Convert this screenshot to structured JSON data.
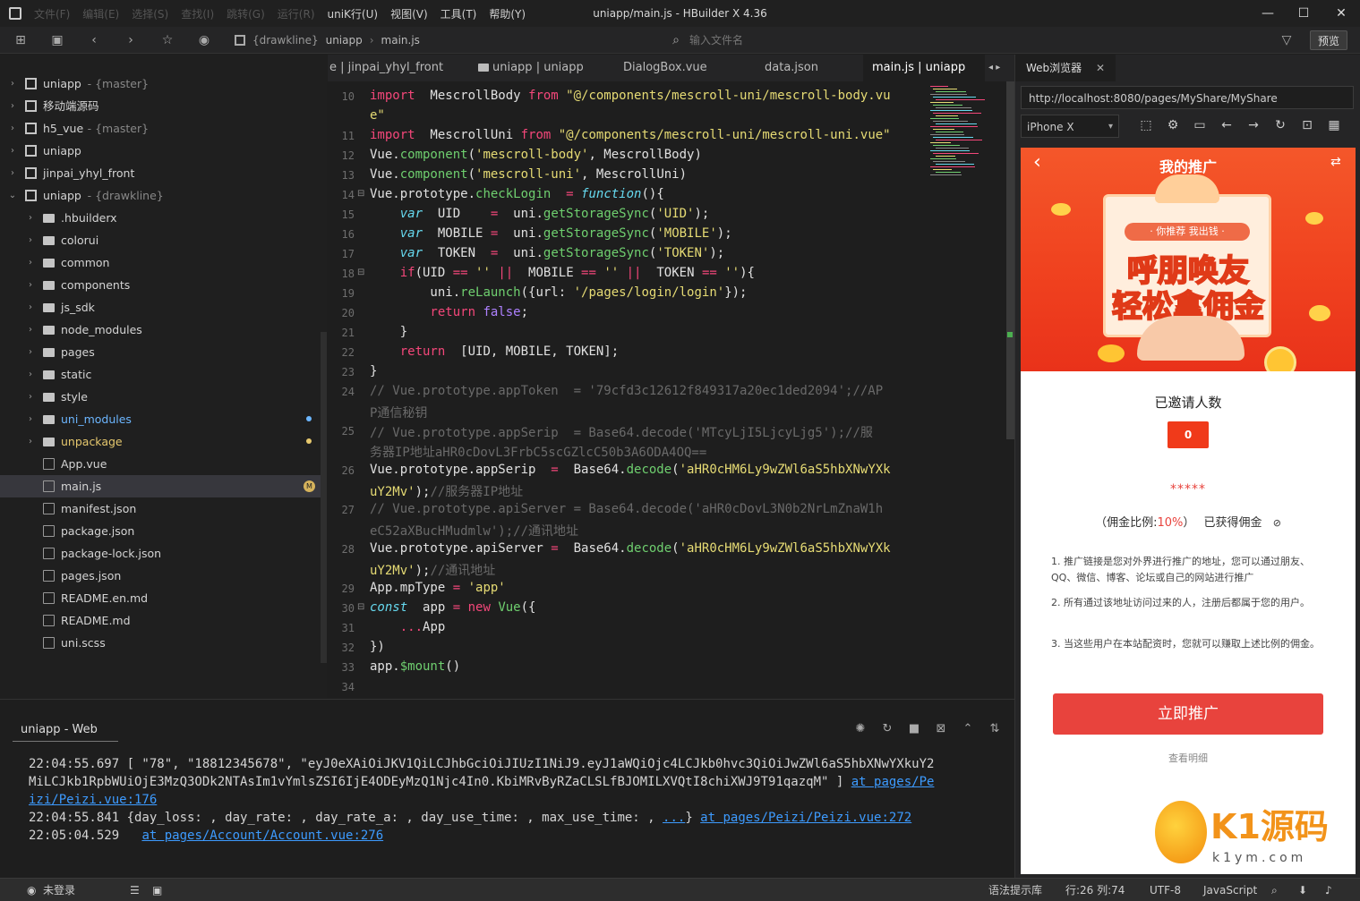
{
  "titlebar": {
    "menu": [
      "文件(F)",
      "编辑(E)",
      "选择(S)",
      "查找(I)",
      "跳转(G)",
      "运行(R)",
      "uniK行(U)",
      "视图(V)",
      "工具(T)",
      "帮助(Y)"
    ],
    "title": "uniapp/main.js - HBuilder X 4.36",
    "minimize": "—",
    "maximize": "☐",
    "close": "✕"
  },
  "toolbar": {
    "crumb_root": "{drawkline}",
    "crumb_project": "uniapp",
    "crumb_sep": "›",
    "crumb_file": "main.js",
    "file_input_placeholder": "输入文件名",
    "preview_label": "预览"
  },
  "sidebar": {
    "items": [
      {
        "label": "uniapp",
        "branch": "- {master}",
        "arrow": "›",
        "icon": "project",
        "depth": 0
      },
      {
        "label": "移动端源码",
        "branch": "",
        "arrow": "›",
        "icon": "folder-project",
        "depth": 0
      },
      {
        "label": "h5_vue",
        "branch": "- {master}",
        "arrow": "›",
        "icon": "project",
        "depth": 0
      },
      {
        "label": "uniapp",
        "branch": "",
        "arrow": "›",
        "icon": "project",
        "depth": 0
      },
      {
        "label": "jinpai_yhyl_front",
        "branch": "",
        "arrow": "›",
        "icon": "project",
        "depth": 0
      },
      {
        "label": "uniapp",
        "branch": "- {drawkline}",
        "arrow": "⌄",
        "icon": "project",
        "depth": 0
      },
      {
        "label": ".hbuilderx",
        "branch": "",
        "arrow": "›",
        "icon": "folder",
        "depth": 1
      },
      {
        "label": "colorui",
        "branch": "",
        "arrow": "›",
        "icon": "folder",
        "depth": 1
      },
      {
        "label": "common",
        "branch": "",
        "arrow": "›",
        "icon": "folder",
        "depth": 1
      },
      {
        "label": "components",
        "branch": "",
        "arrow": "›",
        "icon": "folder",
        "depth": 1
      },
      {
        "label": "js_sdk",
        "branch": "",
        "arrow": "›",
        "icon": "folder",
        "depth": 1
      },
      {
        "label": "node_modules",
        "branch": "",
        "arrow": "›",
        "icon": "folder",
        "depth": 1
      },
      {
        "label": "pages",
        "branch": "",
        "arrow": "›",
        "icon": "folder",
        "depth": 1
      },
      {
        "label": "static",
        "branch": "",
        "arrow": "›",
        "icon": "folder",
        "depth": 1
      },
      {
        "label": "style",
        "branch": "",
        "arrow": "›",
        "icon": "folder",
        "depth": 1
      },
      {
        "label": "uni_modules",
        "branch": "",
        "arrow": "›",
        "icon": "folder",
        "depth": 1,
        "color": "#6cb6ff",
        "dot": "#6cb6ff"
      },
      {
        "label": "unpackage",
        "branch": "",
        "arrow": "›",
        "icon": "folder",
        "depth": 1,
        "color": "#e6c86e",
        "dot": "#e6c86e"
      },
      {
        "label": "App.vue",
        "branch": "",
        "arrow": "",
        "icon": "vue",
        "depth": 1
      },
      {
        "label": "main.js",
        "branch": "",
        "arrow": "",
        "icon": "js",
        "depth": 1,
        "selected": true,
        "badge": "M"
      },
      {
        "label": "manifest.json",
        "branch": "",
        "arrow": "",
        "icon": "manifest",
        "depth": 1
      },
      {
        "label": "package.json",
        "branch": "",
        "arrow": "",
        "icon": "json",
        "depth": 1
      },
      {
        "label": "package-lock.json",
        "branch": "",
        "arrow": "",
        "icon": "json",
        "depth": 1
      },
      {
        "label": "pages.json",
        "branch": "",
        "arrow": "",
        "icon": "json",
        "depth": 1
      },
      {
        "label": "README.en.md",
        "branch": "",
        "arrow": "",
        "icon": "md",
        "depth": 1
      },
      {
        "label": "README.md",
        "branch": "",
        "arrow": "",
        "icon": "md",
        "depth": 1
      },
      {
        "label": "uni.scss",
        "branch": "",
        "arrow": "",
        "icon": "scss",
        "depth": 1
      }
    ]
  },
  "tabs": [
    "e | jinpai_yhyl_front",
    "uniapp | uniapp",
    "DialogBox.vue",
    "data.json",
    "main.js | uniapp"
  ],
  "tab_scroll": "◂ ▸",
  "editor": {
    "lines": [
      {
        "n": "10",
        "fold": "",
        "t": [
          [
            "k",
            "import"
          ],
          [
            "",
            "  MescrollBody "
          ],
          [
            "k",
            "from"
          ],
          [
            "",
            ""
          ],
          [
            "s",
            " \"@/components/mescroll-uni/mescroll-body.vu"
          ]
        ]
      },
      {
        "n": "",
        "fold": "",
        "t": [
          [
            "s",
            "e\""
          ]
        ]
      },
      {
        "n": "11",
        "fold": "",
        "t": [
          [
            "k",
            "import"
          ],
          [
            "",
            "  MescrollUni "
          ],
          [
            "k",
            "from"
          ],
          [
            "s",
            " \"@/components/mescroll-uni/mescroll-uni.vue\""
          ]
        ]
      },
      {
        "n": "12",
        "fold": "",
        "t": [
          [
            "",
            "Vue."
          ],
          [
            "f",
            "component"
          ],
          [
            "",
            "("
          ],
          [
            "s",
            "'mescroll-body'"
          ],
          [
            "",
            ", MescrollBody)"
          ]
        ]
      },
      {
        "n": "13",
        "fold": "",
        "t": [
          [
            "",
            "Vue."
          ],
          [
            "f",
            "component"
          ],
          [
            "",
            "("
          ],
          [
            "s",
            "'mescroll-uni'"
          ],
          [
            "",
            ", MescrollUni)"
          ]
        ]
      },
      {
        "n": "14",
        "fold": "⊟",
        "t": [
          [
            "",
            "Vue.prototype."
          ],
          [
            "f",
            "checkLogin"
          ],
          [
            "",
            "  "
          ],
          [
            "k",
            "="
          ],
          [
            "",
            ""
          ],
          [
            "v",
            " function"
          ],
          [
            "",
            "(){"
          ]
        ]
      },
      {
        "n": "15",
        "fold": "",
        "t": [
          [
            "v",
            "    var"
          ],
          [
            "",
            "  UID    "
          ],
          [
            "k",
            "="
          ],
          [
            "",
            "  uni."
          ],
          [
            "f",
            "getStorageSync"
          ],
          [
            "",
            "("
          ],
          [
            "s",
            "'UID'"
          ],
          [
            "",
            ");"
          ]
        ]
      },
      {
        "n": "16",
        "fold": "",
        "t": [
          [
            "v",
            "    var"
          ],
          [
            "",
            "  MOBILE "
          ],
          [
            "k",
            "="
          ],
          [
            "",
            "  uni."
          ],
          [
            "f",
            "getStorageSync"
          ],
          [
            "",
            "("
          ],
          [
            "s",
            "'MOBILE'"
          ],
          [
            "",
            ");"
          ]
        ]
      },
      {
        "n": "17",
        "fold": "",
        "t": [
          [
            "v",
            "    var"
          ],
          [
            "",
            "  TOKEN  "
          ],
          [
            "k",
            "="
          ],
          [
            "",
            "  uni."
          ],
          [
            "f",
            "getStorageSync"
          ],
          [
            "",
            "("
          ],
          [
            "s",
            "'TOKEN'"
          ],
          [
            "",
            ");"
          ]
        ]
      },
      {
        "n": "18",
        "fold": "⊟",
        "t": [
          [
            "k",
            "    if"
          ],
          [
            "",
            "(UID "
          ],
          [
            "k",
            "=="
          ],
          [
            "s",
            " ''"
          ],
          [
            "k",
            " ||"
          ],
          [
            "",
            "  MOBILE "
          ],
          [
            "k",
            "=="
          ],
          [
            "s",
            " ''"
          ],
          [
            "k",
            " ||"
          ],
          [
            "",
            "  TOKEN "
          ],
          [
            "k",
            "=="
          ],
          [
            "s",
            " ''"
          ],
          [
            "",
            "){"
          ]
        ]
      },
      {
        "n": "19",
        "fold": "",
        "t": [
          [
            "",
            "        uni."
          ],
          [
            "f",
            "reLaunch"
          ],
          [
            "",
            "({url:"
          ],
          [
            "s",
            " '/pages/login/login'"
          ],
          [
            "",
            "});"
          ]
        ]
      },
      {
        "n": "20",
        "fold": "",
        "t": [
          [
            "k",
            "        return"
          ],
          [
            "n",
            " false"
          ],
          [
            "",
            ";"
          ]
        ]
      },
      {
        "n": "21",
        "fold": "",
        "t": [
          [
            "",
            "    }"
          ]
        ]
      },
      {
        "n": "22",
        "fold": "",
        "t": [
          [
            "k",
            "    return"
          ],
          [
            "",
            "  [UID, MOBILE, TOKEN];"
          ]
        ]
      },
      {
        "n": "23",
        "fold": "",
        "t": [
          [
            "",
            "}"
          ]
        ]
      },
      {
        "n": "24",
        "fold": "",
        "t": [
          [
            "c",
            "// Vue.prototype.appToken  = '79cfd3c12612f849317a20ec1ded2094';//AP"
          ]
        ]
      },
      {
        "n": "",
        "fold": "",
        "t": [
          [
            "c",
            "P通信秘钥"
          ]
        ]
      },
      {
        "n": "25",
        "fold": "",
        "t": [
          [
            "c",
            "// Vue.prototype.appSerip  = Base64.decode('MTcyLjI5LjcyLjg5');//服"
          ]
        ]
      },
      {
        "n": "",
        "fold": "",
        "t": [
          [
            "c",
            "务器IP地址aHR0cDovL3FrbC5scGZlcC50b3A6ODA4OQ=="
          ]
        ]
      },
      {
        "n": "26",
        "fold": "",
        "t": [
          [
            "",
            "Vue.prototype.appSerip  "
          ],
          [
            "k",
            "="
          ],
          [
            "",
            "  Base64."
          ],
          [
            "f",
            "decode"
          ],
          [
            "",
            "("
          ],
          [
            "s",
            "'aHR0cHM6Ly9wZWl6aS5hbXNwYXk"
          ]
        ]
      },
      {
        "n": "",
        "fold": "",
        "t": [
          [
            "s",
            "uY2Mv'"
          ],
          [
            "",
            ");"
          ],
          [
            "c",
            "//服务器IP地址"
          ]
        ]
      },
      {
        "n": "27",
        "fold": "",
        "t": [
          [
            "c",
            "// Vue.prototype.apiServer = Base64.decode('aHR0cDovL3N0b2NrLmZnaW1h"
          ]
        ]
      },
      {
        "n": "",
        "fold": "",
        "t": [
          [
            "c",
            "eC52aXBucHMudmlw');//通讯地址"
          ]
        ]
      },
      {
        "n": "28",
        "fold": "",
        "t": [
          [
            "",
            "Vue.prototype.apiServer "
          ],
          [
            "k",
            "="
          ],
          [
            "",
            "  Base64."
          ],
          [
            "f",
            "decode"
          ],
          [
            "",
            "("
          ],
          [
            "s",
            "'aHR0cHM6Ly9wZWl6aS5hbXNwYXk"
          ]
        ]
      },
      {
        "n": "",
        "fold": "",
        "t": [
          [
            "s",
            "uY2Mv'"
          ],
          [
            "",
            ");"
          ],
          [
            "c",
            "//通讯地址"
          ]
        ]
      },
      {
        "n": "29",
        "fold": "",
        "t": [
          [
            "",
            "App.mpType "
          ],
          [
            "k",
            "="
          ],
          [
            "s",
            " 'app'"
          ]
        ]
      },
      {
        "n": "30",
        "fold": "⊟",
        "t": [
          [
            "v",
            "const"
          ],
          [
            "",
            "  app "
          ],
          [
            "k",
            "="
          ],
          [
            "k",
            " new"
          ],
          [
            "f",
            " Vue"
          ],
          [
            "",
            "({"
          ]
        ]
      },
      {
        "n": "31",
        "fold": "",
        "t": [
          [
            "k",
            "    ..."
          ],
          [
            "",
            "App"
          ]
        ]
      },
      {
        "n": "32",
        "fold": "",
        "t": [
          [
            "",
            "})"
          ]
        ]
      },
      {
        "n": "33",
        "fold": "",
        "t": [
          [
            "",
            "app."
          ],
          [
            "f",
            "$mount"
          ],
          [
            "",
            "()"
          ]
        ]
      },
      {
        "n": "34",
        "fold": "",
        "t": [
          [
            "",
            ""
          ]
        ]
      }
    ]
  },
  "browser": {
    "tab_label": "Web浏览器",
    "tab_close": "✕",
    "url": "http://localhost:8080/pages/MyShare/MyShare",
    "device": "iPhone X",
    "device_arrow": "▾"
  },
  "phone": {
    "header_title": "我的推广",
    "banner_tag": "· 你推荐 我出钱 ·",
    "banner_line1": "呼朋唤友",
    "banner_line2": "轻松拿佣金",
    "invited_label": "已邀请人数",
    "invited_count": "0",
    "masked": "*****",
    "ratio_prefix": "（佣金比例:",
    "ratio_value": "10%",
    "ratio_suffix": "）",
    "earned_label": "已获得佣金",
    "rule1": "1. 推广链接是您对外界进行推广的地址，您可以通过朋友、QQ、微信、博客、论坛或自己的网站进行推广",
    "rule2": "2. 所有通过该地址访问过来的人，注册后都属于您的用户。",
    "rule3": "3. 当这些用户在本站配资时，您就可以赚取上述比例的佣金。",
    "promote_button": "立即推广",
    "details_link": "查看明细",
    "watermark_main": "K1源码",
    "watermark_sub": "k1ym.com",
    "colors": {
      "red": "#e8433d",
      "orange": "#f0461f"
    }
  },
  "console": {
    "tab_label": "uniapp - Web",
    "lines": [
      [
        [
          "",
          "22:04:55.697 [ \"78\", \"18812345678\", \"eyJ0eXAiOiJKV1QiLCJhbGciOiJIUzI1NiJ9.eyJ1aWQiOjc4LCJkb0hvc3QiOiJwZWl6aS5hbXNwYXkuY2"
        ]
      ],
      [
        [
          "",
          "MiLCJkb1RpbWUiOjE3MzQ3ODk2NTAsIm1vYmlsZSI6IjE4ODEyMzQ1Njc4In0.KbiMRvByRZaCLSLfBJOMILXVQtI8chiXWJ9T91qazqM\" ] "
        ],
        [
          "lk",
          "at pages/Pe"
        ]
      ],
      [
        [
          "lk",
          "izi/Peizi.vue:176"
        ]
      ],
      [
        [
          "",
          "22:04:55.841 {day_loss: , day_rate: , day_rate_a: , day_use_time: , max_use_time: , "
        ],
        [
          "lk",
          "..."
        ],
        [
          "",
          "} "
        ],
        [
          "lk",
          "at pages/Peizi/Peizi.vue:272"
        ]
      ],
      [
        [
          "",
          "22:05:04.529   "
        ],
        [
          "lk",
          "at pages/Account/Account.vue:276"
        ]
      ]
    ]
  },
  "status": {
    "login": "未登录",
    "hint": "语法提示库",
    "position": "行:26  列:74",
    "encoding": "UTF-8",
    "language": "JavaScript"
  }
}
